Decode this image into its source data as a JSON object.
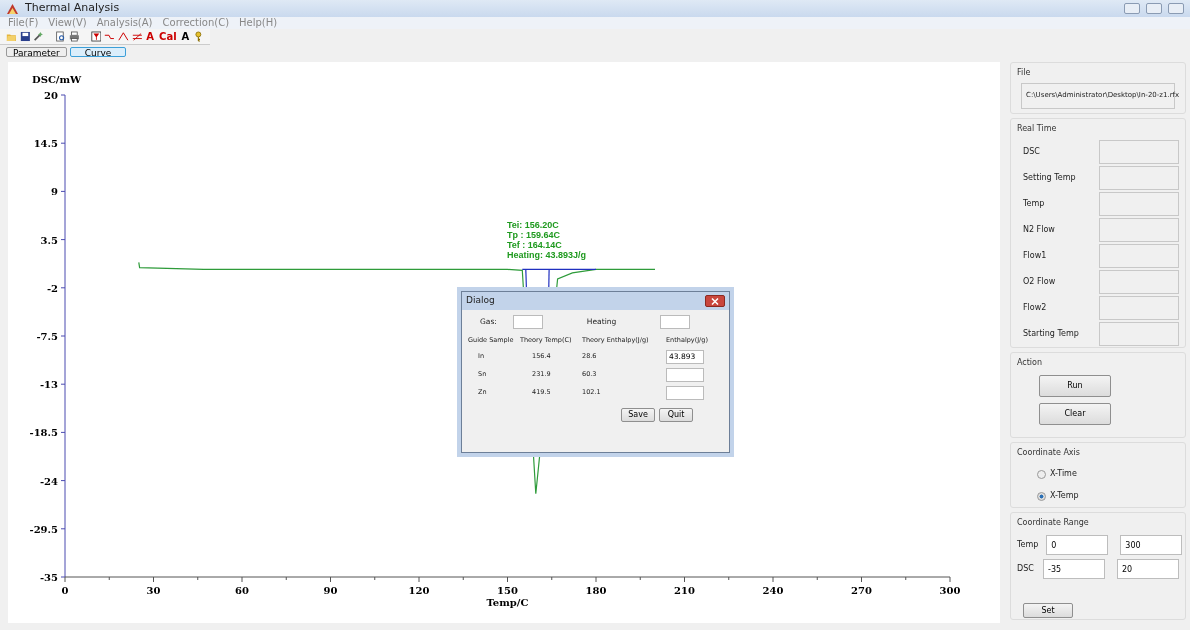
{
  "window": {
    "title": "Thermal Analysis"
  },
  "menu": [
    "File(F)",
    "View(V)",
    "Analysis(A)",
    "Correction(C)",
    "Help(H)"
  ],
  "toolbar_labels": [
    {
      "text": "A",
      "color": "#cc0000"
    },
    {
      "text": "Cal",
      "color": "#cc0000"
    },
    {
      "text": "A",
      "color": "#000000"
    }
  ],
  "tabs": [
    {
      "label": "Parameter",
      "selected": false
    },
    {
      "label": "Curve",
      "selected": true
    }
  ],
  "chart": {
    "chart_data": {
      "type": "line",
      "xlabel": "Temp/C",
      "ylabel": "DSC/mW",
      "xlim": [
        0,
        300
      ],
      "ylim": [
        -35,
        20
      ],
      "xticks": [
        0,
        30,
        60,
        90,
        120,
        150,
        180,
        210,
        240,
        270,
        300
      ],
      "yticks": [
        20,
        14.5,
        9,
        3.5,
        -2,
        -7.5,
        -13,
        -18.5,
        -24,
        -29.5,
        -35
      ],
      "series": [
        {
          "color": "#2e9b3a",
          "x": [
            25,
            25.3,
            47,
            150,
            155,
            159.6,
            167,
            172,
            180,
            200
          ],
          "values": [
            0.9,
            0.3,
            0.1,
            0.1,
            0.0,
            -25.5,
            -1,
            -0.3,
            0.1,
            0.1
          ]
        },
        {
          "color": "#2030c0",
          "x": [
            155,
            180
          ],
          "values": [
            0.1,
            0.1
          ]
        },
        {
          "color": "#2030c0",
          "x": [
            156.2,
            156.4
          ],
          "values": [
            0.1,
            -2
          ]
        },
        {
          "color": "#2030c0",
          "x": [
            164.1,
            164
          ],
          "values": [
            0.1,
            -2
          ]
        }
      ],
      "annotations": [
        {
          "text": "Tei: 156.20C"
        },
        {
          "text": "Tp : 159.64C"
        },
        {
          "text": "Tef : 164.14C"
        },
        {
          "text": "Heating: 43.893J/g"
        }
      ]
    }
  },
  "dialog": {
    "title": "Dialog",
    "gas_label": "Gas:",
    "heating_label": "Heating",
    "columns": [
      "Guide Sample",
      "Theory Temp(C)",
      "Theory Enthalpy(J/g)",
      "Enthalpy(J/g)"
    ],
    "rows": [
      {
        "sample": "In",
        "temp": "156.4",
        "enthalpy": "28.6",
        "value": "43.893"
      },
      {
        "sample": "Sn",
        "temp": "231.9",
        "enthalpy": "60.3"
      },
      {
        "sample": "Zn",
        "temp": "419.5",
        "enthalpy": "102.1"
      }
    ],
    "buttons": [
      "Save",
      "Quit"
    ]
  },
  "file": {
    "title": "File",
    "path": "C:\\Users\\Administrator\\Desktop\\In-20-z1.rfx"
  },
  "real_time": {
    "title": "Real Time",
    "fields": [
      "DSC",
      "Setting Temp",
      "Temp",
      "N2 Flow",
      "Flow1",
      "O2 Flow",
      "Flow2",
      "Starting Temp"
    ]
  },
  "action": {
    "title": "Action",
    "buttons": [
      "Run",
      "Clear"
    ]
  },
  "coordinate_axis": {
    "title": "Coordinate Axis",
    "options": [
      {
        "label": "X-Time",
        "selected": false
      },
      {
        "label": "X-Temp",
        "selected": true
      }
    ]
  },
  "coordinate_range": {
    "title": "Coordinate Range",
    "rows": [
      {
        "label": "Temp",
        "min": "0",
        "max": "300"
      },
      {
        "label": "DSC",
        "min": "-35",
        "max": "20"
      }
    ],
    "button": "Set"
  }
}
